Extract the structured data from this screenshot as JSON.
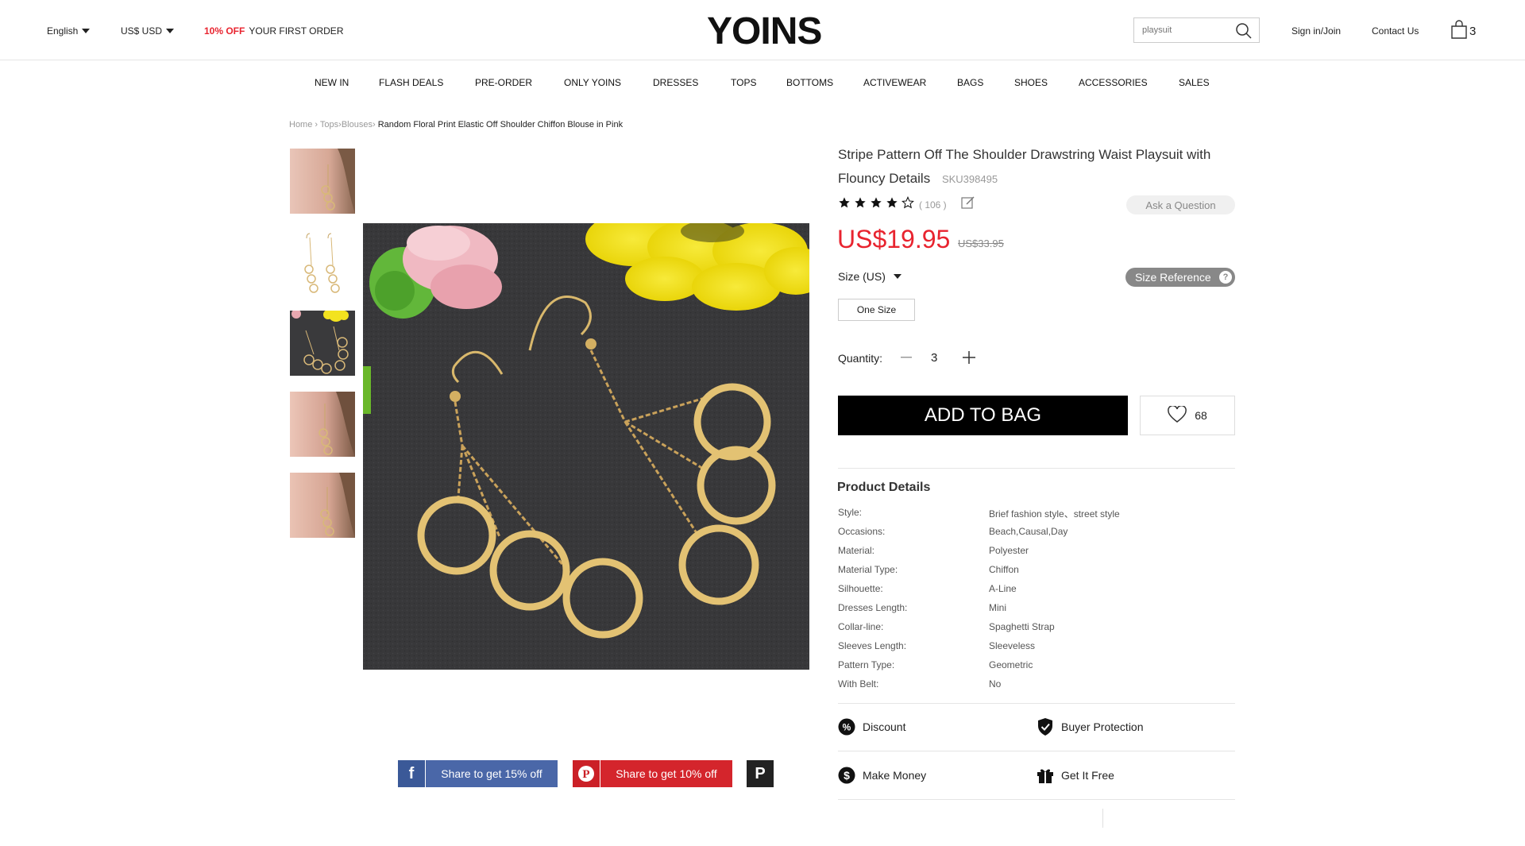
{
  "topbar": {
    "language": "English",
    "currency": "US$ USD",
    "promo_highlight": "10% OFF",
    "promo_text": "YOUR FIRST ORDER",
    "logo": "YOINS",
    "search_placeholder": "playsuit",
    "sign_in": "Sign in/Join",
    "contact": "Contact Us",
    "cart_count": "3"
  },
  "nav": [
    "NEW IN",
    "FLASH DEALS",
    "PRE-ORDER",
    "ONLY YOINS",
    "DRESSES",
    "TOPS",
    "BOTTOMS",
    "ACTIVEWEAR",
    "BAGS",
    "SHOES",
    "ACCESSORIES",
    "SALES"
  ],
  "breadcrumb": {
    "home": "Home",
    "tops": "Tops",
    "blouses": "Blouses",
    "current": "Random Floral Print Elastic Off Shoulder Chiffon Blouse in Pink"
  },
  "share": {
    "facebook": "Share to get 15% off",
    "pinterest": "Share to get 10% off"
  },
  "product": {
    "title": "Stripe Pattern Off The Shoulder Drawstring Waist Playsuit with Flouncy Details",
    "sku": "SKU398495",
    "rating": 4,
    "review_count": "( 106 )",
    "ask_question": "Ask a Question",
    "price": "US$19.95",
    "old_price": "US$33.95",
    "size_label": "Size (US)",
    "size_reference": "Size Reference",
    "size_option": "One Size",
    "quantity_label": "Quantity:",
    "quantity": "3",
    "add_to_bag": "ADD TO BAG",
    "wishlist_count": "68",
    "details_title": "Product Details",
    "specs": [
      {
        "k": "Style:",
        "v": "Brief fashion style、street style"
      },
      {
        "k": "Occasions:",
        "v": "Beach,Causal,Day"
      },
      {
        "k": "Material:",
        "v": "Polyester"
      },
      {
        "k": "Material Type:",
        "v": "Chiffon"
      },
      {
        "k": "Silhouette:",
        "v": "A-Line"
      },
      {
        "k": "Dresses Length:",
        "v": "Mini"
      },
      {
        "k": "Collar-line:",
        "v": "Spaghetti Strap"
      },
      {
        "k": "Sleeves Length:",
        "v": "Sleeveless"
      },
      {
        "k": "Pattern Type:",
        "v": "Geometric"
      },
      {
        "k": "With Belt:",
        "v": "No"
      }
    ],
    "features": {
      "discount": "Discount",
      "buyer_protection": "Buyer Protection",
      "make_money": "Make Money",
      "get_free": "Get It Free"
    }
  },
  "colors": {
    "accent_red": "#e8242f",
    "facebook": "#3b5998",
    "pinterest": "#cb2027"
  }
}
